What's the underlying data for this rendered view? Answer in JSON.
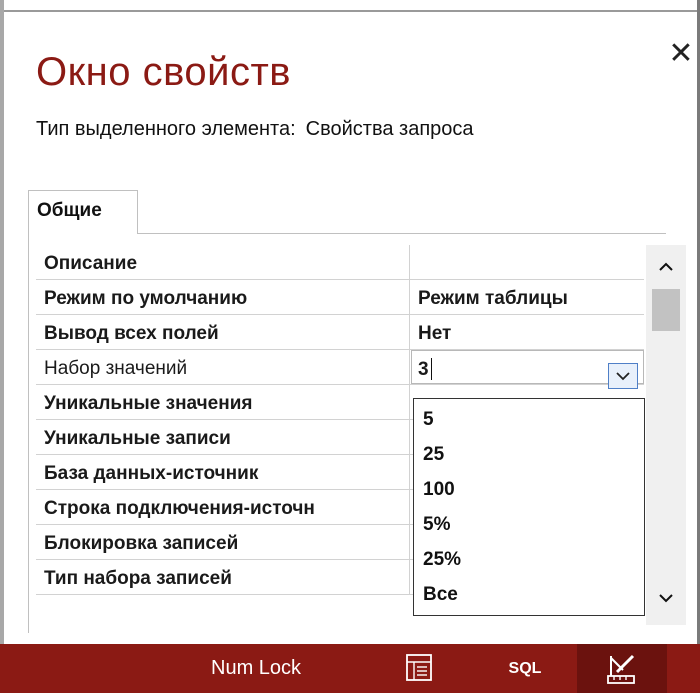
{
  "window": {
    "title": "Окно свойств",
    "close_glyph": "✕"
  },
  "selection": {
    "label": "Тип выделенного элемента:",
    "value": "Свойства запроса"
  },
  "tabs": [
    {
      "label": "Общие",
      "active": true
    }
  ],
  "properties": [
    {
      "name": "Описание",
      "value": ""
    },
    {
      "name": "Режим по умолчанию",
      "value": "Режим таблицы"
    },
    {
      "name": "Вывод всех полей",
      "value": "Нет"
    },
    {
      "name": "Набор значений",
      "value": "3",
      "editing": true
    },
    {
      "name": "Уникальные значения",
      "value": ""
    },
    {
      "name": "Уникальные записи",
      "value": ""
    },
    {
      "name": "База данных-источник",
      "value": ""
    },
    {
      "name": "Строка подключения-источн",
      "value": ""
    },
    {
      "name": "Блокировка записей",
      "value": ""
    },
    {
      "name": "Тип набора записей",
      "value": ""
    }
  ],
  "dropdown": {
    "open": true,
    "options": [
      "5",
      "25",
      "100",
      "5%",
      "25%",
      "Все"
    ]
  },
  "scrollbar": {
    "up_glyph": "^",
    "down_glyph": "v"
  },
  "statusbar": {
    "num_lock": "Num Lock",
    "sql_label": "SQL",
    "datasheet_icon": "datasheet-view-icon",
    "design_icon": "design-view-icon"
  },
  "colors": {
    "accent": "#8b1a14",
    "accent_dark": "#6b120e",
    "dropdown_button_border": "#4f7fc7"
  }
}
